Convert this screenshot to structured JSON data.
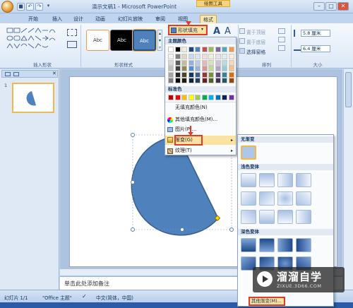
{
  "window": {
    "title": "演示文稿1 - Microsoft PowerPoint",
    "contextual_tab": "绘图工具",
    "minimize": "–",
    "maximize": "□",
    "close": "✕"
  },
  "qat": {
    "save": "■",
    "undo": "↶",
    "redo": "↷",
    "more": "▾"
  },
  "tabs": [
    "开始",
    "插入",
    "设计",
    "动画",
    "幻灯片放映",
    "审阅",
    "视图",
    "格式"
  ],
  "ribbon": {
    "insert_shapes_label": "插入形状",
    "shape_styles_label": "形状样式",
    "style_sample": "Abc",
    "shape_fill": "形状填充",
    "arrange_label": "排列",
    "bring_forward": "置于顶层",
    "send_backward": "置于底层",
    "selection_pane": "选择窗格",
    "size_label": "大小",
    "height_value": "5.8 厘米",
    "width_value": "6.4 厘米"
  },
  "fill_menu": {
    "theme_colors": "主题颜色",
    "standard_colors": "标准色",
    "no_fill": "无填充颜色(N)",
    "more_colors": "其他填充颜色(M)...",
    "picture": "图片(P)...",
    "gradient": "渐变(G)",
    "texture": "纹理(T)",
    "theme_color_rows": [
      [
        "#ffffff",
        "#000000",
        "#eeece1",
        "#1f497d",
        "#4f81bd",
        "#c0504d",
        "#9bbb59",
        "#8064a2",
        "#4bacc6",
        "#f79646"
      ],
      [
        "#f2f2f2",
        "#7f7f7f",
        "#ddd9c3",
        "#c6d9f0",
        "#dbe5f1",
        "#f2dcdb",
        "#ebf1dd",
        "#e5e0ec",
        "#dbeef3",
        "#fdeada"
      ],
      [
        "#d8d8d8",
        "#595959",
        "#c4bd97",
        "#8db3e2",
        "#b8cce4",
        "#e5b9b7",
        "#d7e3bc",
        "#ccc1d9",
        "#b7dde8",
        "#fbd5b5"
      ],
      [
        "#bfbfbf",
        "#3f3f3f",
        "#938953",
        "#548dd4",
        "#95b3d7",
        "#d99694",
        "#c3d69b",
        "#b2a2c7",
        "#92cddc",
        "#fac08f"
      ],
      [
        "#a5a5a5",
        "#262626",
        "#494429",
        "#17365d",
        "#366092",
        "#953734",
        "#76923c",
        "#5f497a",
        "#31859b",
        "#e36c09"
      ],
      [
        "#7f7f7f",
        "#0c0c0c",
        "#1d1b10",
        "#0f243e",
        "#244061",
        "#632423",
        "#4f6128",
        "#3f3151",
        "#205867",
        "#974806"
      ]
    ],
    "standard_color_row": [
      "#c00000",
      "#ff0000",
      "#ffc000",
      "#ffff00",
      "#92d050",
      "#00b050",
      "#00b0f0",
      "#0070c0",
      "#002060",
      "#7030a0"
    ]
  },
  "grad_menu": {
    "no_gradient": "无渐变",
    "light_variations": "浅色变体",
    "dark_variations": "深色变体",
    "more_gradients": "其他渐变(M)..."
  },
  "left_panel": {
    "slide_number": "1"
  },
  "notes_placeholder": "单击此处添加备注",
  "status": {
    "slide_info": "幻灯片 1/1",
    "theme": "\"Office 主题\"",
    "language": "中文(简体，中国)"
  },
  "watermark": {
    "brand": "溜溜自学",
    "url": "ZIXUE.3D66.COM"
  },
  "colors": {
    "shape_fill": "#4f81bd",
    "highlight_red": "#e03c2a",
    "accent_orange": "#f1b84e"
  }
}
